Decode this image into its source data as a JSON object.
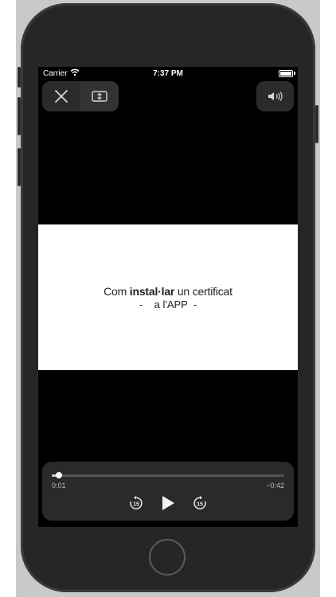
{
  "status_bar": {
    "carrier": "Carrier",
    "time": "7:37 PM"
  },
  "video": {
    "title_prefix": "Com ",
    "title_bold": "instal·lar",
    "title_suffix": " un certificat",
    "subtitle": "-    a l'APP  -"
  },
  "player": {
    "elapsed": "0:01",
    "remaining": "−0:42",
    "progress_fraction": 0.03,
    "skip_back_seconds": "15",
    "skip_forward_seconds": "15"
  },
  "icons": {
    "close": "close-icon",
    "resize": "resize-video-icon",
    "volume": "volume-icon",
    "play": "play-icon",
    "skip_back": "skip-back-15-icon",
    "skip_forward": "skip-forward-15-icon",
    "wifi": "wifi-icon",
    "battery": "battery-icon"
  }
}
